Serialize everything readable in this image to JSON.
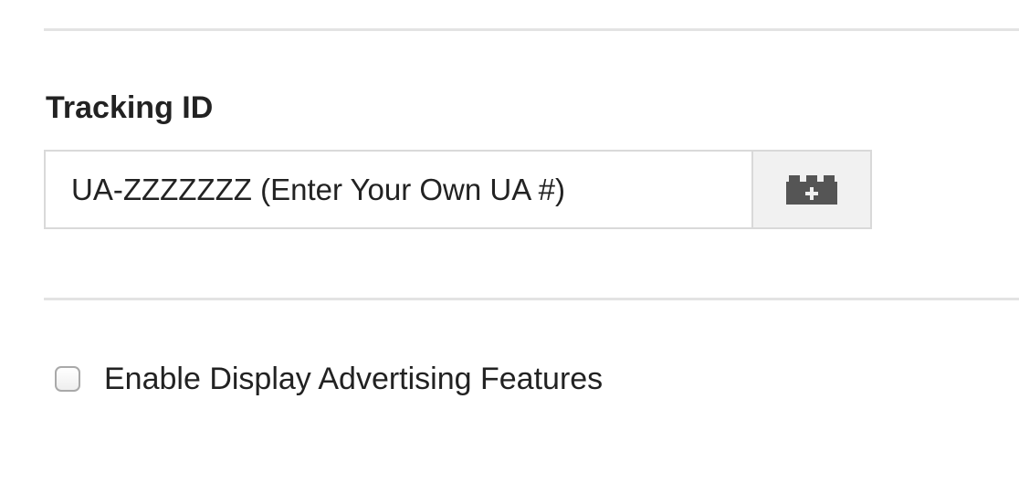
{
  "tracking": {
    "section_label": "Tracking ID",
    "input_value": "UA-ZZZZZZZ (Enter Your Own UA #)",
    "macro_button_icon": "variable-brick-plus-icon"
  },
  "display_advertising": {
    "checkbox_checked": false,
    "checkbox_label": "Enable Display Advertising Features"
  },
  "colors": {
    "divider": "#e3e3e3",
    "input_border": "#d9d9d9",
    "button_background": "#f1f1f1",
    "icon": "#555555",
    "text": "#222222"
  }
}
